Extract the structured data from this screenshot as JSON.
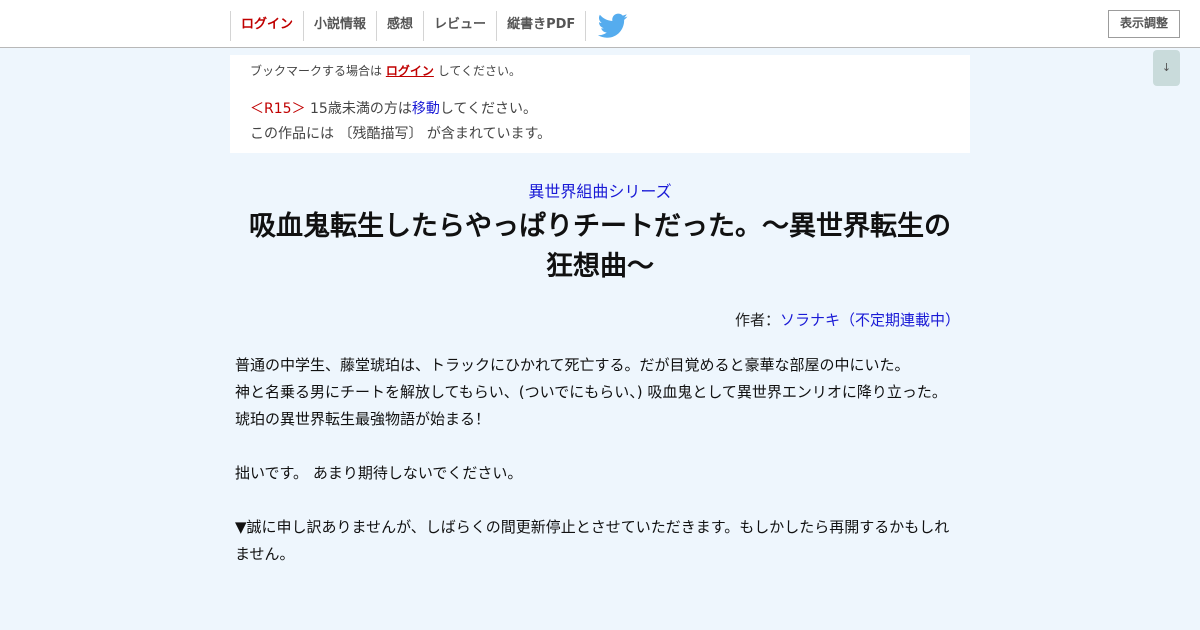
{
  "header": {
    "nav": [
      {
        "label": "ログイン",
        "active": true
      },
      {
        "label": "小説情報",
        "active": false
      },
      {
        "label": "感想",
        "active": false
      },
      {
        "label": "レビュー",
        "active": false
      },
      {
        "label": "縦書きPDF",
        "active": false
      }
    ],
    "twitter_icon": "twitter-bird-icon",
    "display_settings_label": "表示調整",
    "scroll_down_label": "↓"
  },
  "notice": {
    "bookmark_prefix": "ブックマークする場合は",
    "bookmark_link": "ログイン",
    "bookmark_suffix": "してください。",
    "r15_tag": "＜R15＞",
    "r15_text": "15歳未満の方は",
    "r15_link": "移動",
    "r15_suffix": "してください。",
    "content_warning": "この作品には 〔残酷描写〕 が含まれています。"
  },
  "novel": {
    "series": "異世界組曲シリーズ",
    "title_line1": "吸血鬼転生したらやっぱりチートだった。〜異世界転生の",
    "title_line2": "狂想曲〜",
    "author_label": "作者：",
    "author_name": "ソラナキ（不定期連載中）",
    "synopsis": [
      "普通の中学生、藤堂琥珀は、トラックにひかれて死亡する。だが目覚めると豪華な部屋の中にいた。",
      "神と名乗る男にチートを解放してもらい、(ついでにもらい、) 吸血鬼として異世界エンリオに降り立った。",
      "琥珀の異世界転生最強物語が始まる！",
      "",
      "拙いです。 あまり期待しないでください。",
      "",
      "▼誠に申し訳ありませんが、しばらくの間更新停止とさせていただきます。もしかしたら再開するかもしれ",
      "ません。"
    ]
  },
  "colors": {
    "background": "#eef6fd",
    "link": "#1a1ad6",
    "accent_red": "#c00000",
    "twitter_blue": "#55acee"
  }
}
